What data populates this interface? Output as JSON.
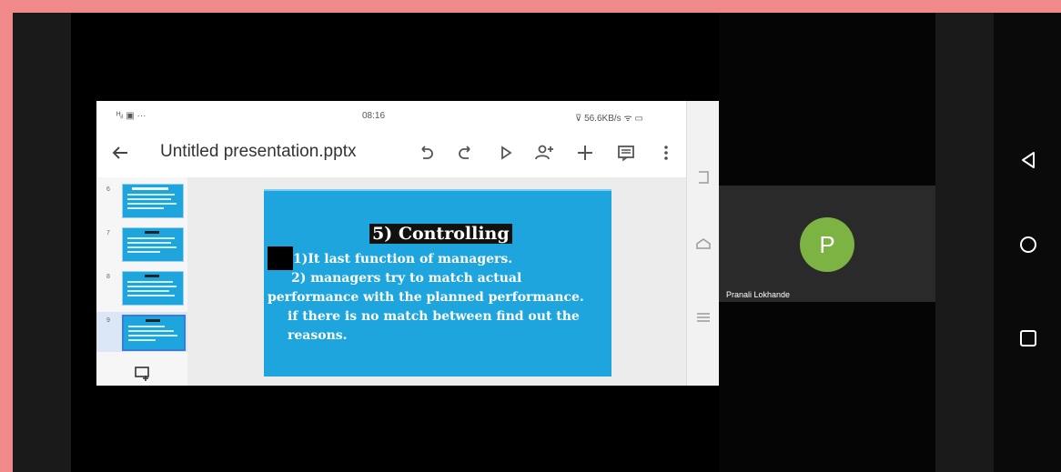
{
  "status_bar": {
    "left": "ᴴᵢₗ ▣ ···",
    "time": "08:16",
    "right": "⊽ 56.6KB/s ᯤ ▭"
  },
  "app": {
    "doc_title": "Untitled presentation.pptx",
    "toolbar_icons": [
      "back-arrow-icon",
      "undo-icon",
      "redo-icon",
      "play-icon",
      "add-person-icon",
      "plus-icon",
      "comment-icon",
      "more-vert-icon"
    ]
  },
  "thumbnails": [
    {
      "number": "6"
    },
    {
      "number": "7"
    },
    {
      "number": "8"
    },
    {
      "number": "9",
      "selected": true
    }
  ],
  "slide": {
    "title": "5) Controlling",
    "lines": [
      "1)It last function of managers.",
      "2) managers try to match actual",
      "performance with the planned performance.",
      "if there is no match between find out the",
      "reasons."
    ]
  },
  "participant": {
    "initial": "P",
    "name": "Pranali Lokhande",
    "avatar_color": "#7cb342"
  },
  "android_nav": [
    "back-triangle-icon",
    "home-circle-icon",
    "recents-square-icon"
  ]
}
